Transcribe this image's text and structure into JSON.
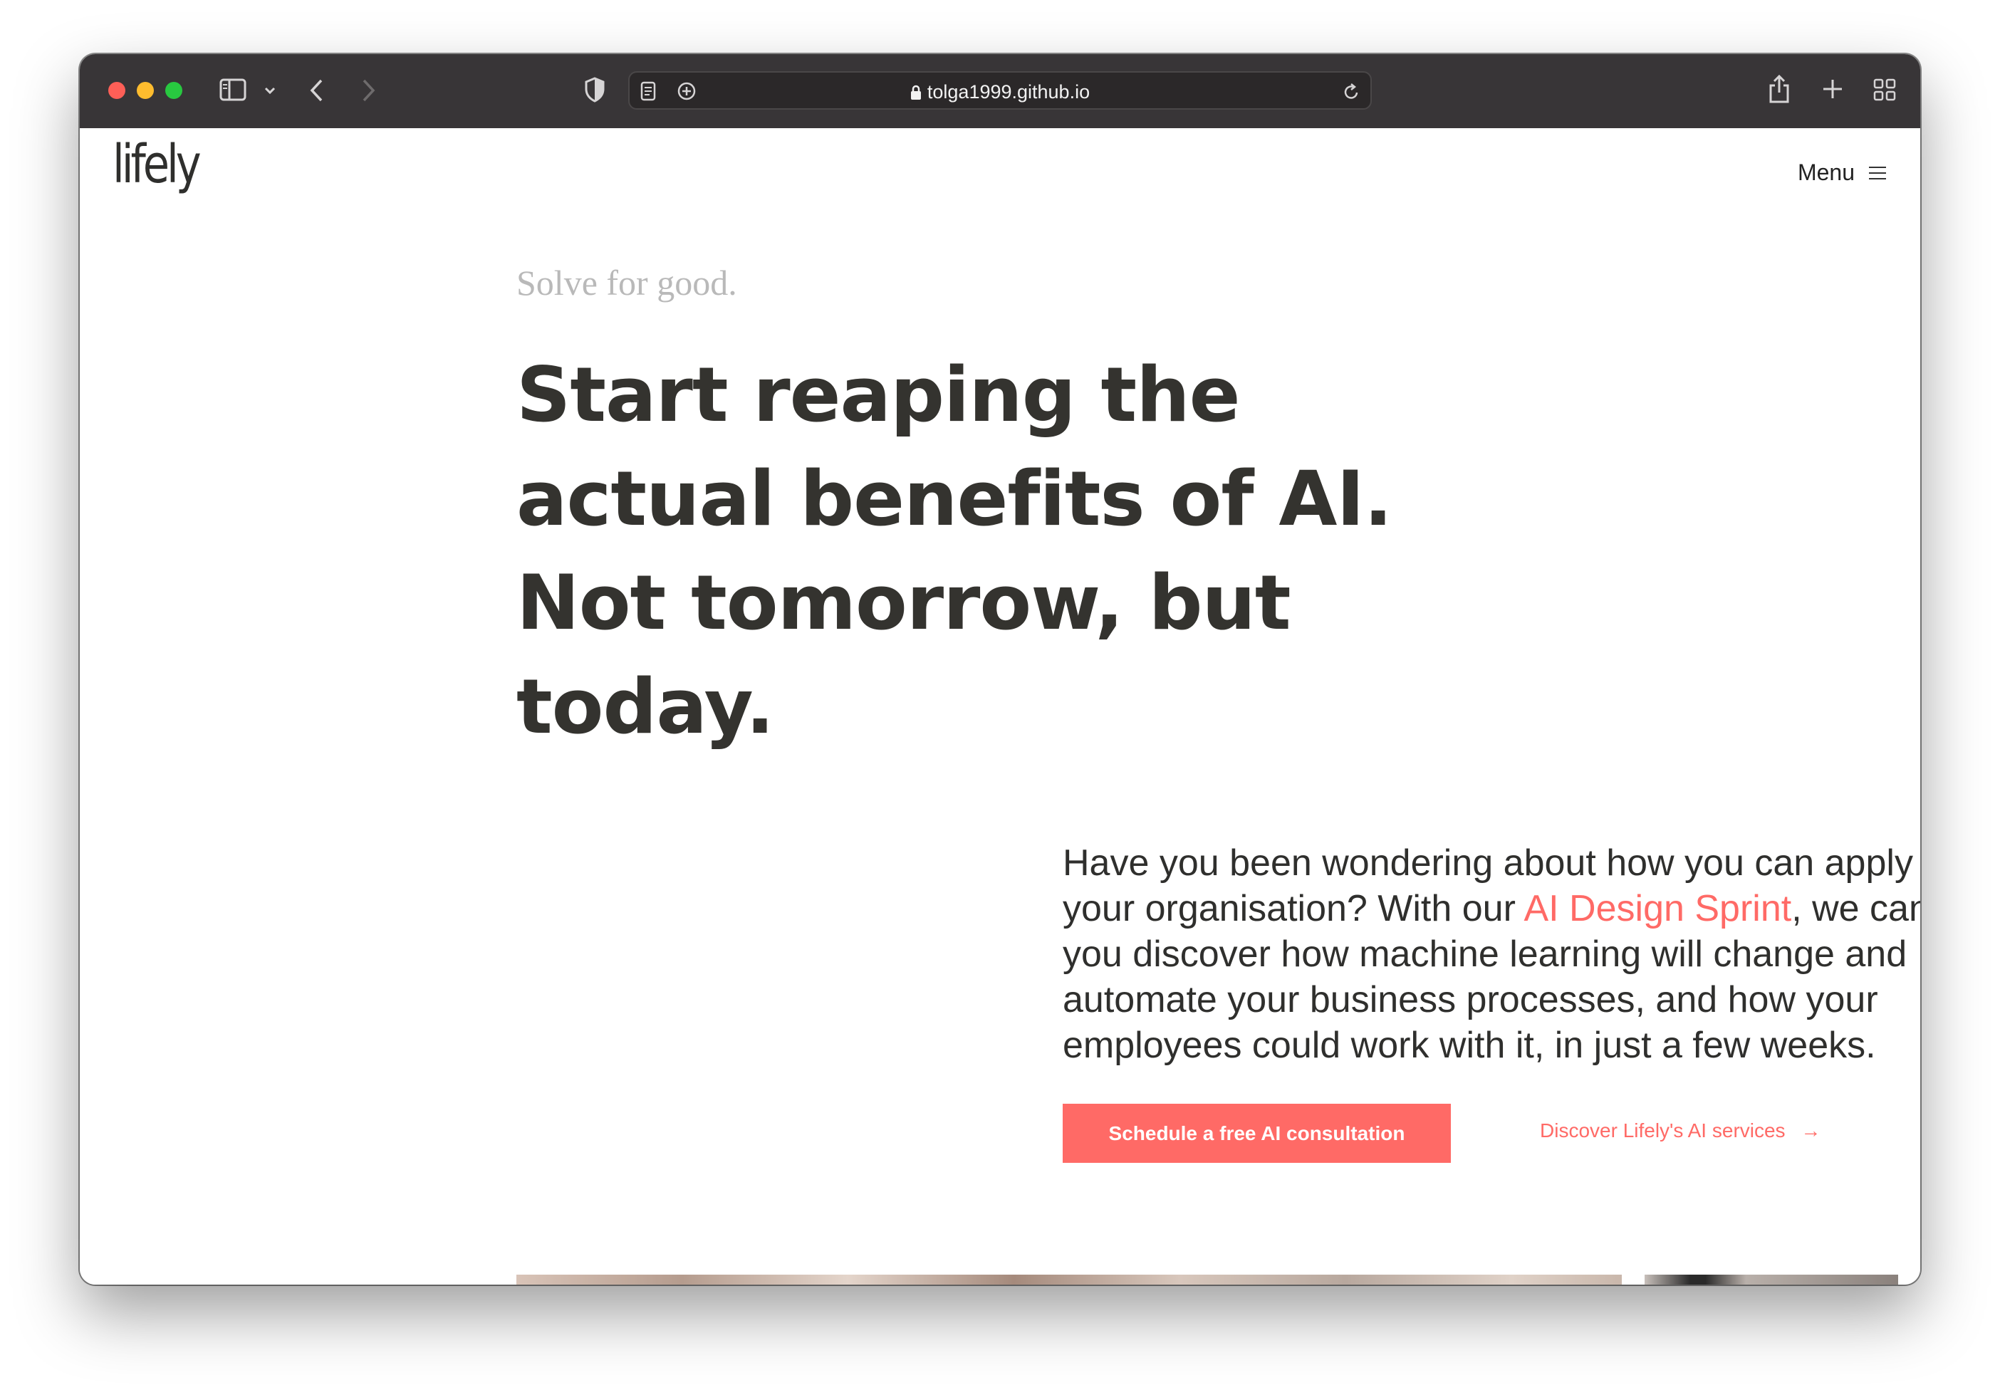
{
  "browser": {
    "url": "tolga1999.github.io"
  },
  "site": {
    "logo": "lifely",
    "menu_label": "Menu"
  },
  "hero": {
    "tagline": "Solve for good.",
    "headline_lines": [
      "Start reaping the",
      "actual benefits of AI.",
      "Not tomorrow, but",
      "today."
    ],
    "body_before_link": "Have you been wondering about how you can apply AI in your organisation? With our ",
    "body_link": "AI Design Sprint",
    "body_after_link": ", we can help you discover how machine learning will change and automate your business processes, and how your employees could work with it, in just a few weeks.",
    "cta_label": "Schedule a free AI consultation",
    "secondary_link": "Discover Lifely's AI services",
    "secondary_arrow": "→"
  },
  "colors": {
    "accent": "#ff6a66",
    "text": "#34332f",
    "titlebar": "#383537"
  }
}
